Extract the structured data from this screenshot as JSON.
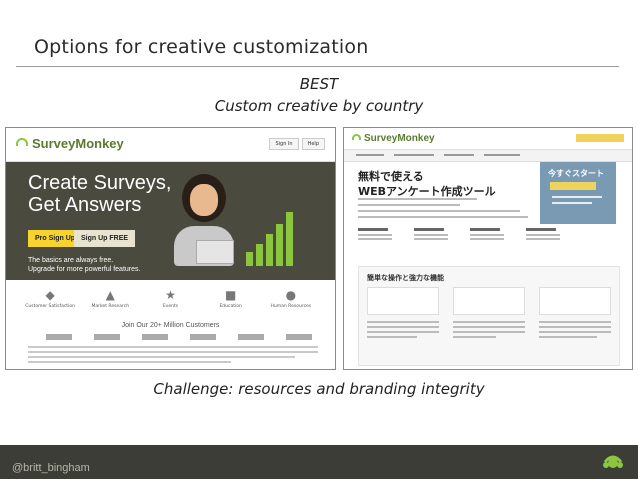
{
  "slide": {
    "title": "Options for creative customization",
    "best_label": "BEST",
    "subtitle": "Custom creative by country",
    "caption": "Challenge: resources and branding integrity",
    "footer_handle": "@britt_bingham"
  },
  "left_screenshot": {
    "logo_text": "SurveyMonkey",
    "header_buttons": [
      "Sign In",
      "Help"
    ],
    "headline_line1": "Create Surveys,",
    "headline_line2": "Get Answers",
    "cta_pro": "Pro Sign Up",
    "cta_free": "Sign Up FREE",
    "sub_line1": "The basics are always free.",
    "sub_line2": "Upgrade for more powerful features.",
    "features": [
      {
        "label": "Customer Satisfaction",
        "icon": "megaphone-icon",
        "glyph": "◆"
      },
      {
        "label": "Market Research",
        "icon": "chart-icon",
        "glyph": "▲"
      },
      {
        "label": "Events",
        "icon": "star-icon",
        "glyph": "★"
      },
      {
        "label": "Education",
        "icon": "book-icon",
        "glyph": "■"
      },
      {
        "label": "Human Resources",
        "icon": "people-icon",
        "glyph": "●"
      }
    ],
    "customers_line": "Join Our 20+ Million Customers"
  },
  "right_screenshot": {
    "logo_text": "SurveyMonkey",
    "headline_line1": "無料で使える",
    "headline_line2": "WEBアンケート作成ツール",
    "panel_title": "今すぐスタート",
    "section_title": "簡単な操作と強力な機能"
  },
  "colors": {
    "hero_bg": "#4b4a3f",
    "brand_green": "#8cc63f",
    "cta_yellow": "#f6d32d",
    "footer_bg": "#3d3d38"
  }
}
